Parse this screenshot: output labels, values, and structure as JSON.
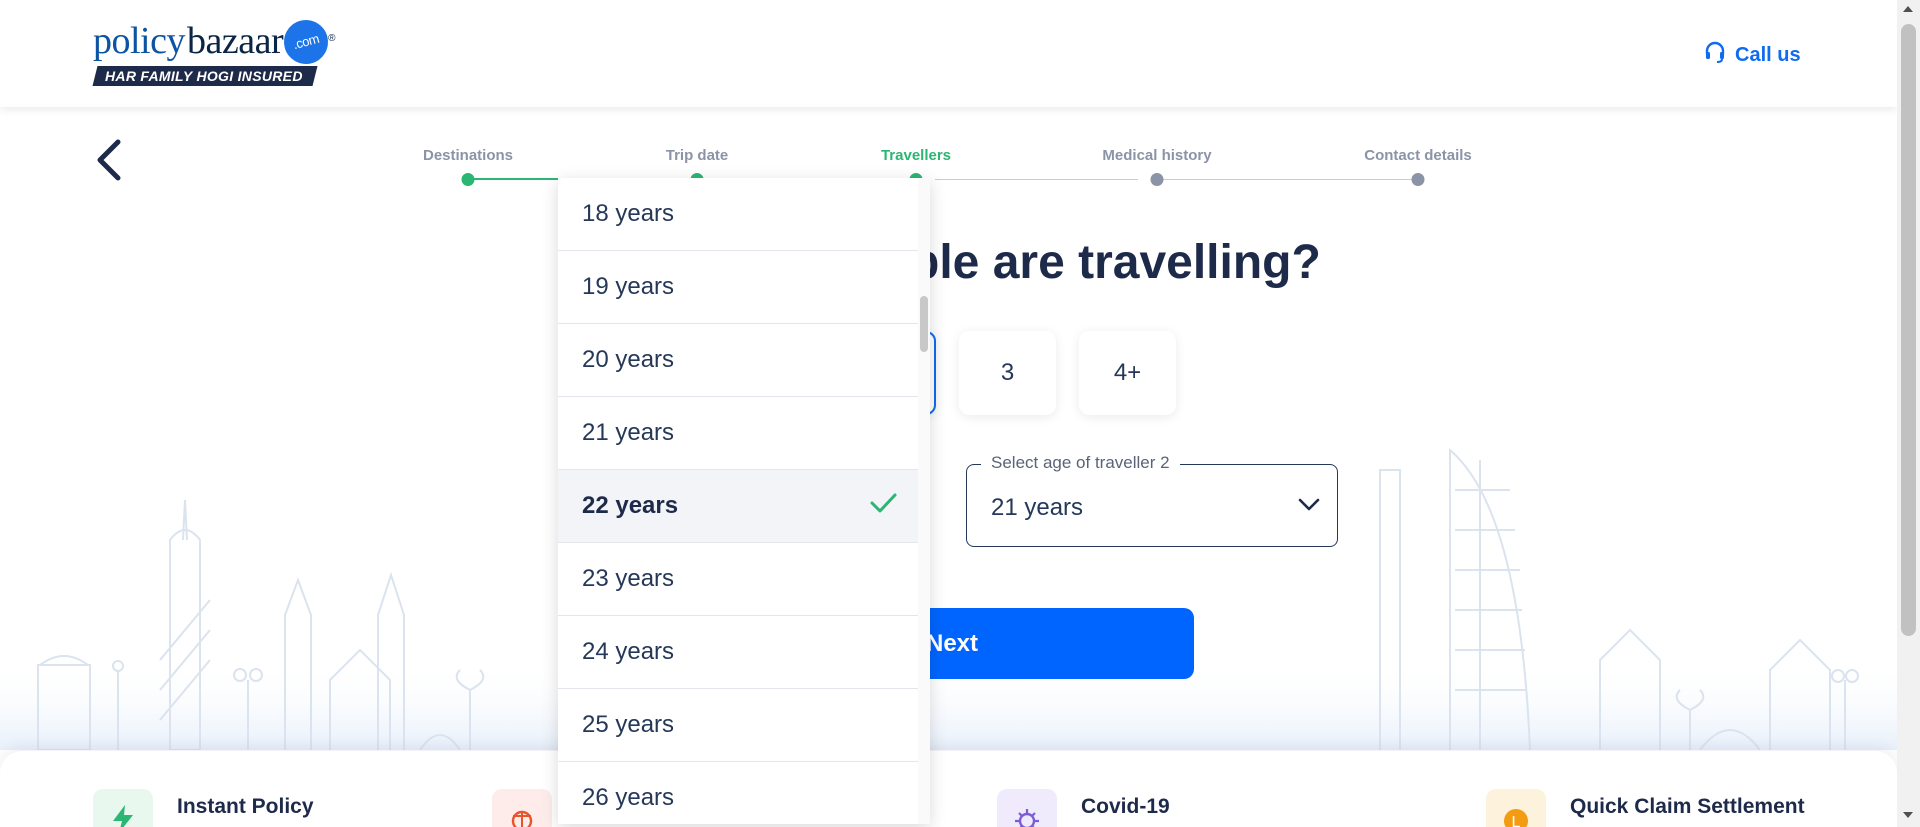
{
  "brand": {
    "name_light": "policy",
    "name_bold": "bazaar",
    "dot_com": ".com",
    "registered": "®",
    "tagline": "HAR FAMILY HOGI INSURED"
  },
  "header": {
    "call_label": "Call us",
    "call_icon": "headset-icon"
  },
  "stepper": {
    "steps": [
      {
        "label": "Destinations",
        "state": "done"
      },
      {
        "label": "Trip date",
        "state": "done"
      },
      {
        "label": "Travellers",
        "state": "active"
      },
      {
        "label": "Medical history",
        "state": "pending"
      },
      {
        "label": "Contact details",
        "state": "pending"
      }
    ]
  },
  "main": {
    "question_visible": "ple are travelling?",
    "counts": [
      "3",
      "4+"
    ],
    "age_select": {
      "legend": "Select age of traveller 2",
      "value": "21 years"
    },
    "next_label": "Next"
  },
  "dropdown": {
    "options": [
      "18 years",
      "19 years",
      "20 years",
      "21 years",
      "22 years",
      "23 years",
      "24 years",
      "25 years",
      "26 years"
    ],
    "selected": "22 years"
  },
  "features": [
    {
      "title": "Instant Policy",
      "icon": "lightning-icon",
      "color": "#2bb673",
      "bg": "#e8f8ef"
    },
    {
      "title": "",
      "icon": "globe-icon",
      "color": "#e8552b",
      "bg": "#fdecea"
    },
    {
      "title": "Covid-19",
      "icon": "virus-icon",
      "color": "#7b5cd6",
      "bg": "#efeafc"
    },
    {
      "title": "Quick Claim Settlement",
      "icon": "coin-icon",
      "color": "#f39c12",
      "bg": "#fdf2dc"
    }
  ],
  "colors": {
    "primary": "#0065ff",
    "success": "#2bb673",
    "text_dark": "#1e2a4a",
    "muted": "#8b93a7"
  }
}
